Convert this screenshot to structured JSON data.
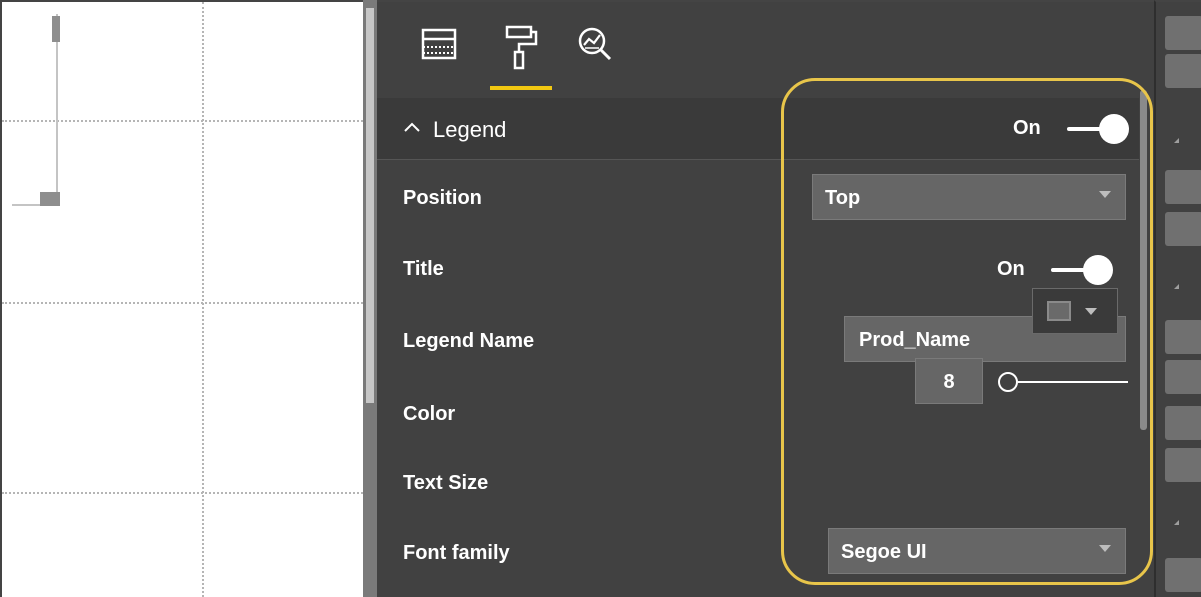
{
  "tabs": [
    {
      "name": "fields-icon",
      "active": false
    },
    {
      "name": "format-paint-roller-icon",
      "active": true
    },
    {
      "name": "analytics-icon",
      "active": false
    }
  ],
  "colors": {
    "pane_bg": "#414141",
    "active_tab_underline": "#f2c811",
    "highlight_outline": "#e8c54a",
    "input_bg": "#666666"
  },
  "legend": {
    "chevron": "^",
    "title": "Legend",
    "toggle_label": "On",
    "toggle_on": true
  },
  "settings": {
    "position": {
      "label": "Position",
      "value": "Top"
    },
    "title": {
      "label": "Title",
      "toggle_label": "On",
      "toggle_on": true
    },
    "legend_name": {
      "label": "Legend Name",
      "value": "Prod_Name"
    },
    "color": {
      "label": "Color",
      "swatch": "#6a6a6a"
    },
    "text_size": {
      "label": "Text Size",
      "value": "8"
    },
    "font_family": {
      "label": "Font family",
      "value": "Segoe UI"
    }
  }
}
